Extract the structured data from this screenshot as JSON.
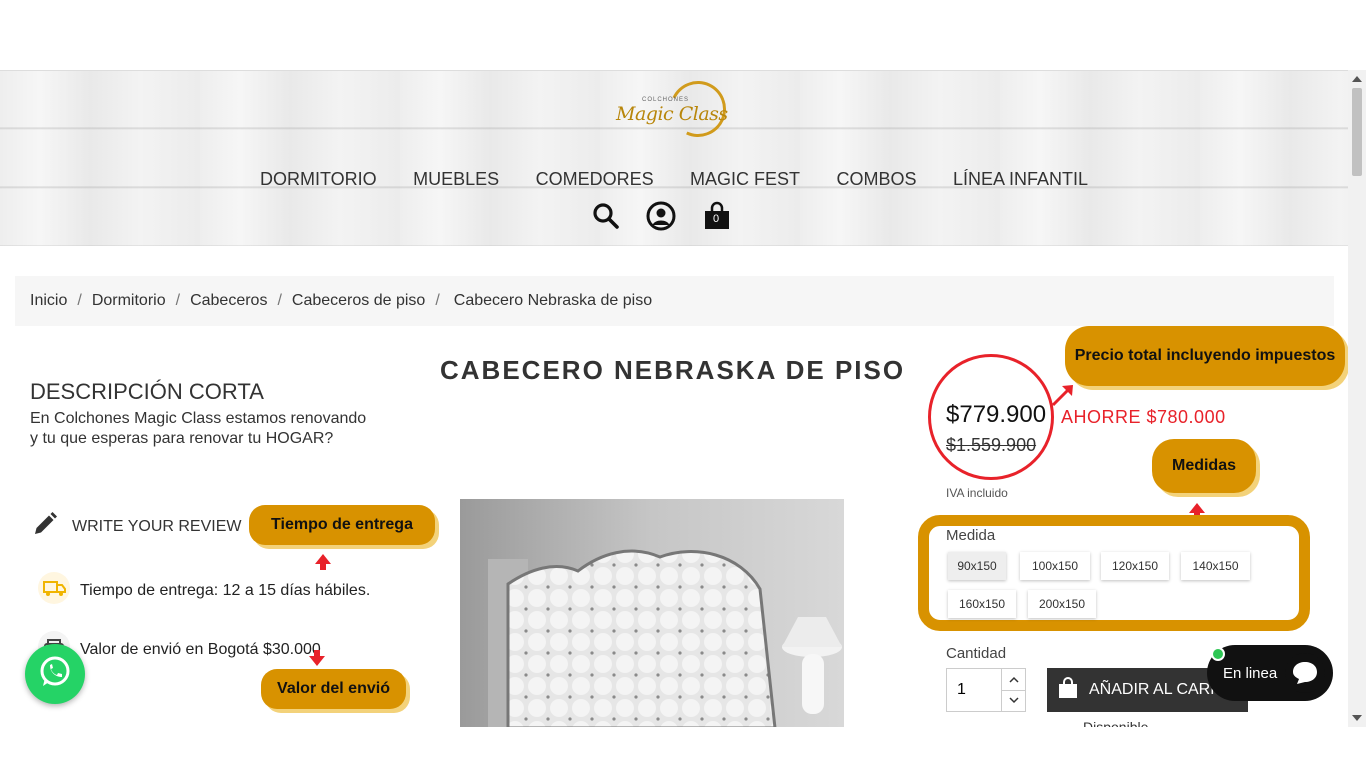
{
  "nav": {
    "items": [
      "DORMITORIO",
      "MUEBLES",
      "COMEDORES",
      "MAGIC FEST",
      "COMBOS",
      "LÍNEA INFANTIL"
    ]
  },
  "logo": {
    "small": "COLCHONES",
    "script": "Magic Class"
  },
  "icons": {
    "search": "search-icon",
    "account": "user-icon",
    "cart": "shopping-bag-icon",
    "cart_count": "0"
  },
  "breadcrumb": [
    "Inicio",
    "Dormitorio",
    "Cabeceros",
    "Cabeceros de piso",
    "Cabecero Nebraska de piso"
  ],
  "product": {
    "title": "CABECERO NEBRASKA DE PISO",
    "short_desc_title": "DESCRIPCIÓN CORTA",
    "short_desc_line1": "En Colchones Magic Class estamos renovando",
    "short_desc_line2": "y tu que esperas para renovar tu HOGAR?",
    "review_label": "WRITE YOUR REVIEW",
    "delivery": "Tiempo de entrega: 12 a 15 días hábiles.",
    "shipping": "Valor de envió en Bogotá $30.000",
    "price": "$779.900",
    "old_price": "$1.559.900",
    "save": "AHORRE $780.000",
    "iva": "IVA incluido",
    "medida_label": "Medida",
    "sizes": [
      "90x150",
      "100x150",
      "120x150",
      "140x150",
      "160x150",
      "200x150"
    ],
    "selected_size": "90x150",
    "cantidad_label": "Cantidad",
    "quantity": "1",
    "add_to_cart": "AÑADIR AL CARRITO",
    "availability": "Disponible"
  },
  "callouts": {
    "precio": "Precio total incluyendo impuestos",
    "medidas": "Medidas",
    "tiempo": "Tiempo de entrega",
    "envio": "Valor del envió"
  },
  "chat": {
    "label": "En linea"
  },
  "colors": {
    "accent": "#d89200",
    "sale": "#e8222a",
    "whatsapp": "#25d366",
    "dark": "#333333"
  }
}
